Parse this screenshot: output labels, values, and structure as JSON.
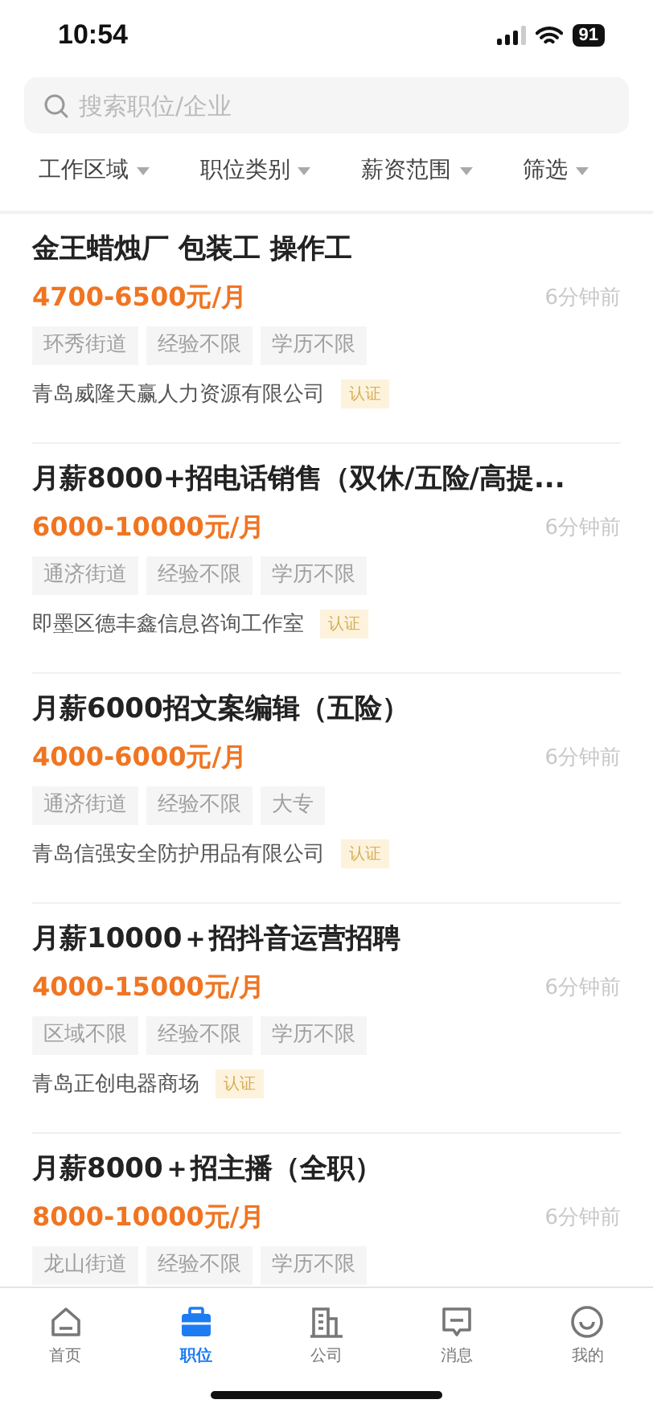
{
  "status_bar": {
    "time": "10:54",
    "battery": "91"
  },
  "search": {
    "placeholder": "搜索职位/企业"
  },
  "filters": [
    {
      "label": "工作区域"
    },
    {
      "label": "职位类别"
    },
    {
      "label": "薪资范围"
    },
    {
      "label": "筛选"
    }
  ],
  "jobs": [
    {
      "title": "金王蜡烛厂 包装工 操作工",
      "salary": "4700-6500元/月",
      "time": "6分钟前",
      "tags": [
        "环秀街道",
        "经验不限",
        "学历不限"
      ],
      "company": "青岛威隆天赢人力资源有限公司",
      "badge": "认证"
    },
    {
      "title": "月薪8000+招电话销售（双休/五险/高提...",
      "salary": "6000-10000元/月",
      "time": "6分钟前",
      "tags": [
        "通济街道",
        "经验不限",
        "学历不限"
      ],
      "company": "即墨区德丰鑫信息咨询工作室",
      "badge": "认证"
    },
    {
      "title": "月薪6000招文案编辑（五险）",
      "salary": "4000-6000元/月",
      "time": "6分钟前",
      "tags": [
        "通济街道",
        "经验不限",
        "大专"
      ],
      "company": "青岛信强安全防护用品有限公司",
      "badge": "认证"
    },
    {
      "title": "月薪10000＋招抖音运营招聘",
      "salary": "4000-15000元/月",
      "time": "6分钟前",
      "tags": [
        "区域不限",
        "经验不限",
        "学历不限"
      ],
      "company": "青岛正创电器商场",
      "badge": "认证"
    },
    {
      "title": "月薪8000＋招主播（全职）",
      "salary": "8000-10000元/月",
      "time": "6分钟前",
      "tags": [
        "龙山街道",
        "经验不限",
        "学历不限"
      ]
    }
  ],
  "tab_bar": [
    {
      "label": "首页",
      "kind": "home",
      "selected": false
    },
    {
      "label": "职位",
      "kind": "jobs",
      "selected": true
    },
    {
      "label": "公司",
      "kind": "company",
      "selected": false
    },
    {
      "label": "消息",
      "kind": "message",
      "selected": false
    },
    {
      "label": "我的",
      "kind": "me",
      "selected": false
    }
  ]
}
